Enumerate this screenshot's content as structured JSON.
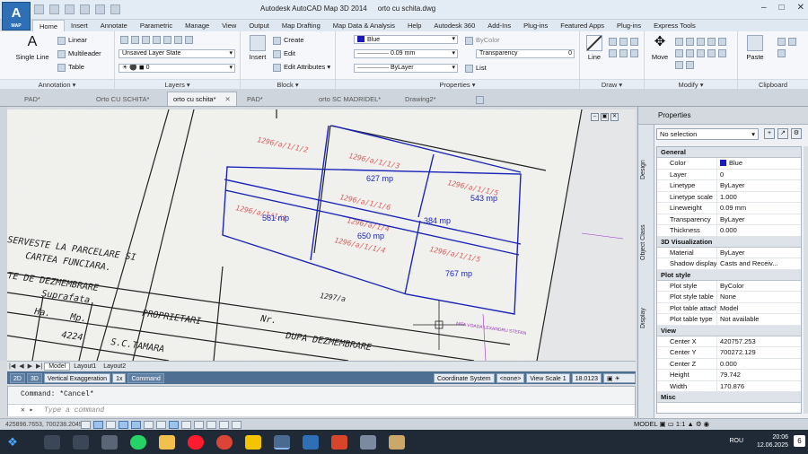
{
  "window": {
    "title": "Autodesk AutoCAD Map 3D 2014",
    "file": "orto cu schita.dwg",
    "app_button": "A",
    "app_button_sub": "MAP"
  },
  "ribbon_tabs": [
    "Home",
    "Insert",
    "Annotate",
    "Parametric",
    "Manage",
    "View",
    "Output",
    "Map Drafting",
    "Map Data & Analysis",
    "Help",
    "Autodesk 360",
    "Add-Ins",
    "Plug-ins",
    "Featured Apps",
    "Plug-ins",
    "Express Tools"
  ],
  "ribbon": {
    "annotation": {
      "title": "Annotation",
      "single_line": "Single Line",
      "linear": "Linear",
      "multileader": "Multileader",
      "table": "Table"
    },
    "layers": {
      "title": "Layers",
      "layer_state": "Unsaved Layer State",
      "current_layer": "0"
    },
    "block": {
      "title": "Block",
      "insert": "Insert",
      "create": "Create",
      "edit": "Edit",
      "edit_attributes": "Edit Attributes"
    },
    "properties": {
      "title": "Properties",
      "color": "Blue",
      "color_hex": "#1a1ab8",
      "color_bylayer": "ByColor",
      "lineweight": "0.09 mm",
      "transparency": "Transparency",
      "transparency_value": "0",
      "linetype": "ByLayer",
      "list": "List"
    },
    "draw": {
      "title": "Draw",
      "line": "Line"
    },
    "modify": {
      "title": "Modify",
      "move": "Move"
    },
    "clipboard": {
      "title": "Clipboard",
      "paste": "Paste"
    }
  },
  "doc_tabs": [
    "PAD*",
    "Orto CU SCHITA*",
    "orto cu schita*",
    "PAD*",
    "orto SC MADRIDEL*",
    "Drawing2*"
  ],
  "drawing": {
    "parcels": [
      "627 mp",
      "543 mp",
      "561 mp",
      "384 mp",
      "650 mp",
      "767 mp"
    ],
    "cadastral_ids": [
      "1296/a/1/1/2",
      "1296/a/1/1/3",
      "1296/a/1/1/5",
      "1296/a/1/1/6",
      "1296/a/1/1/1",
      "1296/a/1/4",
      "1296/a/1/1/4",
      "1296/a/1/1/5"
    ],
    "scan_text": [
      "SERVESTE LA PARCELARE SI",
      "CARTEA FUNCIARA.",
      "TE DE DEZMEMBRARE",
      "Suprafata",
      "Ha.",
      "Mp.",
      "PROPRIETARI",
      "DUPA DEZMEMBRARE",
      "4224",
      "S.C.TAMARA",
      "1297/a",
      "Nr."
    ],
    "street": "NITA VOADA LEXANDRU STEFAN"
  },
  "layout_tabs": [
    "Model",
    "Layout1",
    "Layout2"
  ],
  "map_status": {
    "view2d": "2D",
    "view3d": "3D",
    "vertical_exaggeration": "Vertical Exaggeration",
    "exaggeration_value": "1x",
    "command": "Command",
    "coord_system": "Coordinate System",
    "coord_value": "<none>",
    "view_scale": "View Scale",
    "view_scale_value": "1",
    "scale_value": "18.0123"
  },
  "command_line": {
    "history": "Command: *Cancel*",
    "placeholder": "Type a command"
  },
  "status": {
    "coords": "425896.7653, 700238.2049, 0.0000",
    "model": "MODEL",
    "scale": "1:1"
  },
  "properties_palette": {
    "title": "Properties",
    "selection": "No selection",
    "side_tabs": [
      "Design",
      "Object Class",
      "Display"
    ],
    "sections": [
      {
        "name": "General",
        "rows": [
          {
            "label": "Color",
            "value": "Blue"
          },
          {
            "label": "Layer",
            "value": "0"
          },
          {
            "label": "Linetype",
            "value": "ByLayer"
          },
          {
            "label": "Linetype scale",
            "value": "1.000"
          },
          {
            "label": "Lineweight",
            "value": "0.09 mm"
          },
          {
            "label": "Transparency",
            "value": "ByLayer"
          },
          {
            "label": "Thickness",
            "value": "0.000"
          }
        ]
      },
      {
        "name": "3D Visualization",
        "rows": [
          {
            "label": "Material",
            "value": "ByLayer"
          },
          {
            "label": "Shadow display",
            "value": "Casts and Receiv..."
          }
        ]
      },
      {
        "name": "Plot style",
        "rows": [
          {
            "label": "Plot style",
            "value": "ByColor"
          },
          {
            "label": "Plot style table",
            "value": "None"
          },
          {
            "label": "Plot table attach...",
            "value": "Model"
          },
          {
            "label": "Plot table type",
            "value": "Not available"
          }
        ]
      },
      {
        "name": "View",
        "rows": [
          {
            "label": "Center X",
            "value": "420757.253"
          },
          {
            "label": "Center Y",
            "value": "700272.129"
          },
          {
            "label": "Center Z",
            "value": "0.000"
          },
          {
            "label": "Height",
            "value": "79.742"
          },
          {
            "label": "Width",
            "value": "170.876"
          }
        ]
      },
      {
        "name": "Misc",
        "rows": []
      }
    ]
  },
  "taskbar": {
    "language": "ROU",
    "time": "20:06",
    "date": "12.06.2025",
    "notifications": "6"
  }
}
